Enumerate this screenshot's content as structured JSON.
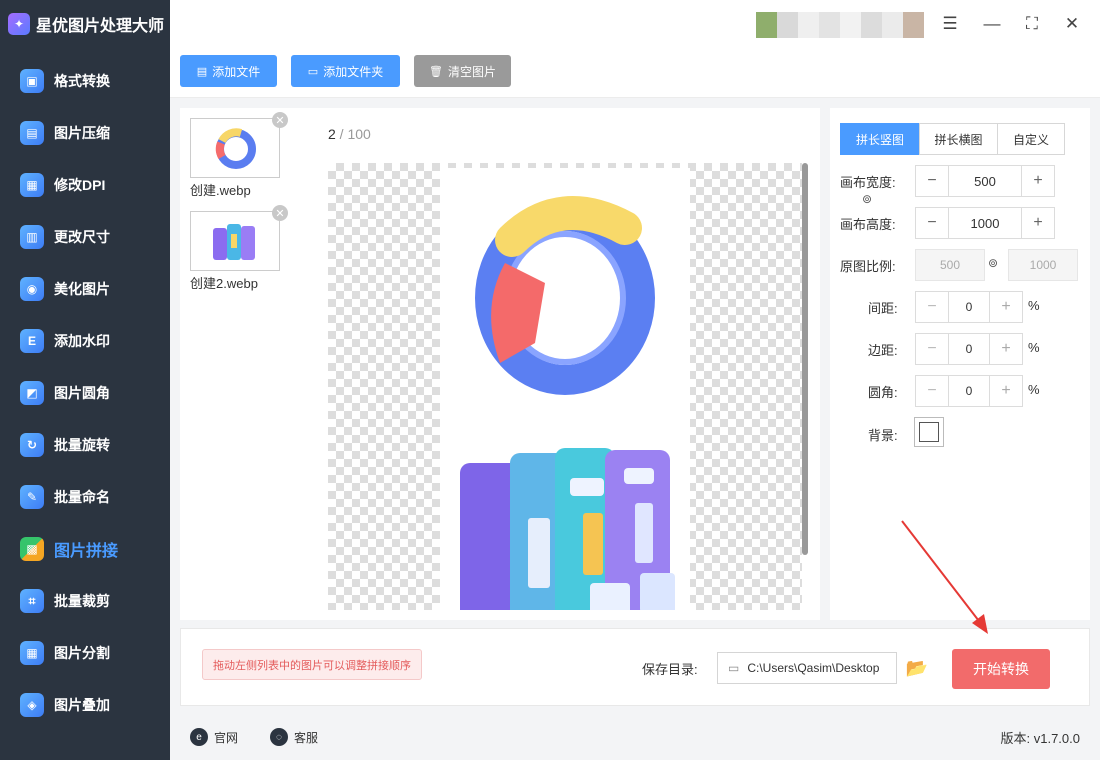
{
  "app": {
    "title": "星优图片处理大师"
  },
  "sidebar": {
    "items": [
      {
        "label": "格式转换",
        "icon": "image-convert-icon"
      },
      {
        "label": "图片压缩",
        "icon": "image-compress-icon"
      },
      {
        "label": "修改DPI",
        "icon": "dpi-icon"
      },
      {
        "label": "更改尺寸",
        "icon": "resize-icon"
      },
      {
        "label": "美化图片",
        "icon": "beautify-icon"
      },
      {
        "label": "添加水印",
        "icon": "watermark-icon"
      },
      {
        "label": "图片圆角",
        "icon": "round-corner-icon"
      },
      {
        "label": "批量旋转",
        "icon": "rotate-icon"
      },
      {
        "label": "批量命名",
        "icon": "rename-icon"
      },
      {
        "label": "图片拼接",
        "icon": "stitch-icon"
      },
      {
        "label": "批量裁剪",
        "icon": "crop-icon"
      },
      {
        "label": "图片分割",
        "icon": "split-icon"
      },
      {
        "label": "图片叠加",
        "icon": "layers-icon"
      }
    ],
    "active_index": 9
  },
  "toolbar": {
    "add_file": "添加文件",
    "add_folder": "添加文件夹",
    "clear": "清空图片"
  },
  "files": [
    {
      "name": "创建.webp"
    },
    {
      "name": "创建2.webp"
    }
  ],
  "preview": {
    "current": "2",
    "separator": " / ",
    "total": "100"
  },
  "settings": {
    "tabs": [
      "拼长竖图",
      "拼长横图",
      "自定义"
    ],
    "active_tab": 0,
    "canvas_width_label": "画布宽度:",
    "canvas_width": "500",
    "canvas_height_label": "画布高度:",
    "canvas_height": "1000",
    "ratio_label": "原图比例:",
    "ratio_w": "500",
    "ratio_h": "1000",
    "spacing_label": "间距:",
    "spacing": "0",
    "margin_label": "边距:",
    "margin": "0",
    "radius_label": "圆角:",
    "radius": "0",
    "percent": "%",
    "background_label": "背景:",
    "background_color": "#ffffff"
  },
  "bottom": {
    "hint": "拖动左侧列表中的图片可以调整拼接顺序",
    "save_label": "保存目录:",
    "save_path": "C:\\Users\\Qasim\\Desktop",
    "start": "开始转换"
  },
  "footer": {
    "website": "官网",
    "support": "客服",
    "version": "版本: v1.7.0.0"
  },
  "colors": {
    "sidebar_bg": "#2b3440",
    "accent": "#4a9bff",
    "start_button": "#f26b6b",
    "toolbar_blue": "#4a9bff",
    "toolbar_gray": "#9a9a9a"
  }
}
